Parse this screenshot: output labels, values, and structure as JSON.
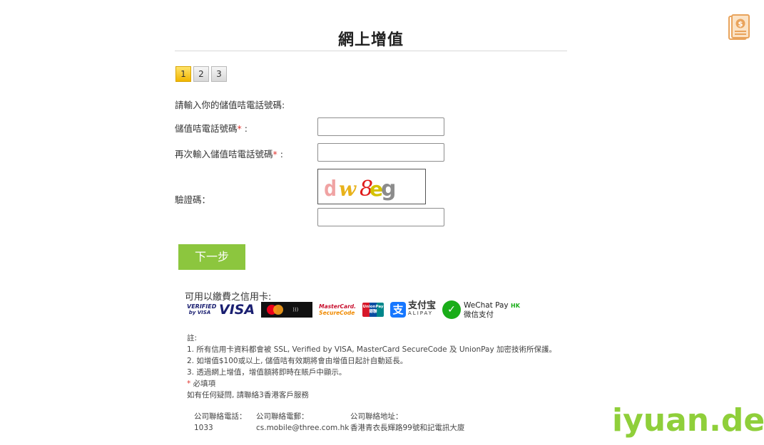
{
  "page": {
    "title": "網上增值",
    "corner_icon": "receipt-dollar-icon"
  },
  "steps": {
    "items": [
      "1",
      "2",
      "3"
    ],
    "active": "1"
  },
  "form": {
    "prompt": "請輸入你的儲值咭電話號碼:",
    "phone_label": "儲值咭電話號碼",
    "confirm_label": "再次輸入儲值咭電話號碼",
    "required_mark": "*",
    "label_suffix": " :",
    "captcha_label": "驗證碼：",
    "captcha_text": "dw8eg",
    "phone_value": "",
    "confirm_value": "",
    "captcha_value": ""
  },
  "actions": {
    "next_label": "下一步"
  },
  "cards": {
    "title": "可用以繳費之信用卡:",
    "verified_visa": [
      "VERIFIED",
      "by VISA"
    ],
    "visa": "VISA",
    "mastercard_sc": [
      "MasterCard.",
      "SecureCode"
    ],
    "unionpay": [
      "UnionPay",
      "銀聯"
    ],
    "alipay": [
      "支付宝",
      "ALIPAY"
    ],
    "wechat": [
      "WeChat Pay",
      "HK",
      "微信支付"
    ],
    "colors": {
      "visa_blue": "#1a1f71",
      "mc_red": "#eb001b",
      "mc_orange": "#f79e1b",
      "alipay_blue": "#1677ff",
      "wechat_green": "#1aad19",
      "button_green": "#8cc63e"
    }
  },
  "notes": {
    "heading": "註:",
    "lines": [
      "1. 所有信用卡資料都會被 SSL, Verified by VISA, MasterCard SecureCode 及 UnionPay 加密技術所保護。",
      "2. 如增值$100或以上, 儲值咭有效期將會由增值日起計自動延長。",
      "3. 透過網上增值，增值額將即時在賬戶中顯示。"
    ],
    "required_marker": "*",
    "required_note": " 必填項",
    "enquiry": "如有任何疑問, 請聯絡3香港客戶服務"
  },
  "contact": {
    "phone_label": "公司聯絡電話：",
    "phone": "1033",
    "email_label": "公司聯絡電郵：",
    "email": "cs.mobile@three.com.hk",
    "address_label": "公司聯絡地址：",
    "address": "香港青衣長輝路99號和記電訊大廈"
  },
  "watermark": "iyuan.de"
}
